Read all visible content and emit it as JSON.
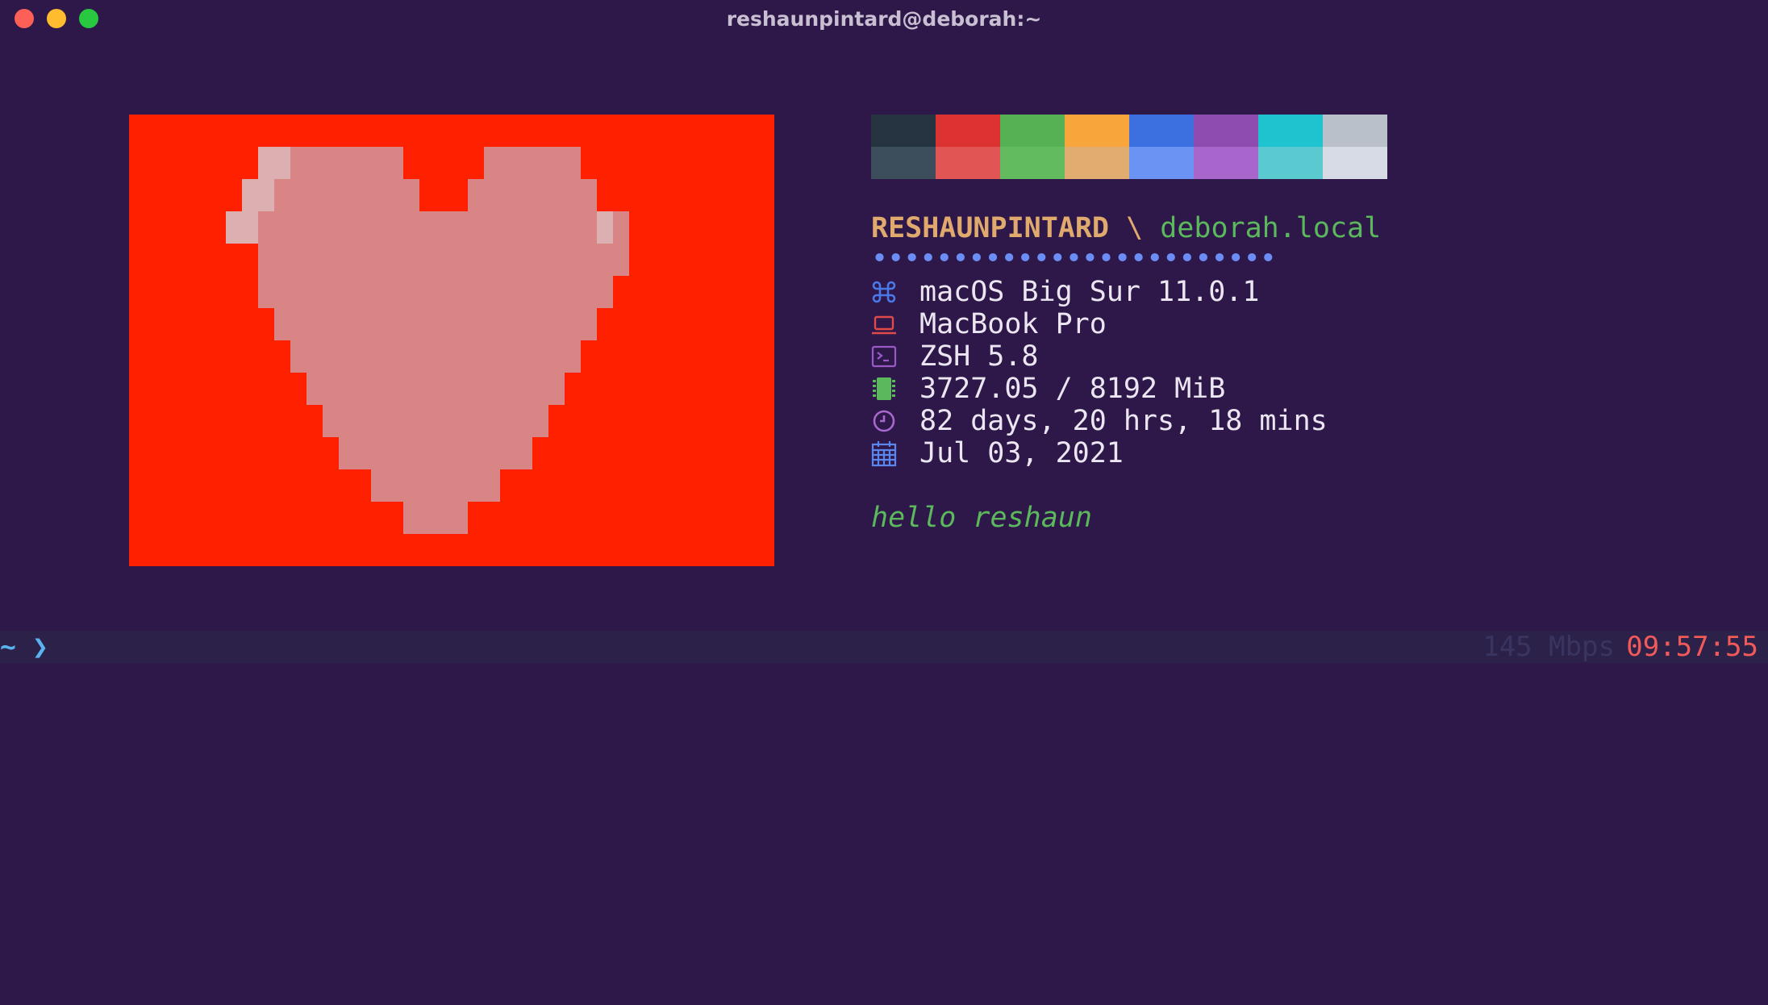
{
  "window": {
    "title": "reshaunpintard@deborah:~"
  },
  "colors": {
    "background": "#2e1849",
    "heart_background": "#ff2000",
    "heart_fill": "#d98585",
    "heart_highlight": "#dcb0b0",
    "username": "#e0a96d",
    "hostname": "#5cb85c",
    "dots": "#6b8df5",
    "greeting": "#5cb85c",
    "prompt": "#5ab3f0",
    "clock": "#f25a5a",
    "net_speed": "#3a3560"
  },
  "palette": {
    "normal": [
      "#263441",
      "#dc3232",
      "#56b054",
      "#f8a63c",
      "#3c6fe0",
      "#8e4bb0",
      "#1fc3cf",
      "#b9c0ca"
    ],
    "bright": [
      "#3c4e5c",
      "#e25555",
      "#62bb5e",
      "#e0ac6f",
      "#6b93f3",
      "#a866cc",
      "#5acad0",
      "#d6dbe6"
    ]
  },
  "header": {
    "user": "RESHAUNPINTARD",
    "separator": " \\ ",
    "host": "deborah.local",
    "dots": "•••••••••••••••••••••••••"
  },
  "info": [
    {
      "icon": "command-icon",
      "color": "#4a78e8",
      "text": "macOS Big Sur 11.0.1"
    },
    {
      "icon": "laptop-icon",
      "color": "#e04a4a",
      "text": "MacBook Pro"
    },
    {
      "icon": "terminal-icon",
      "color": "#9b59c7",
      "text": "ZSH 5.8"
    },
    {
      "icon": "memory-chip-icon",
      "color": "#5cb85c",
      "text": "3727.05 / 8192 MiB"
    },
    {
      "icon": "clock-icon",
      "color": "#a868d0",
      "text": "82 days, 20 hrs, 18 mins"
    },
    {
      "icon": "calendar-icon",
      "color": "#5a86ee",
      "text": "Jul 03, 2021"
    }
  ],
  "greeting": "hello reshaun",
  "prompt": {
    "cwd": "~",
    "caret": "❯",
    "net_speed": "145 Mbps",
    "time": "09:57:55"
  }
}
